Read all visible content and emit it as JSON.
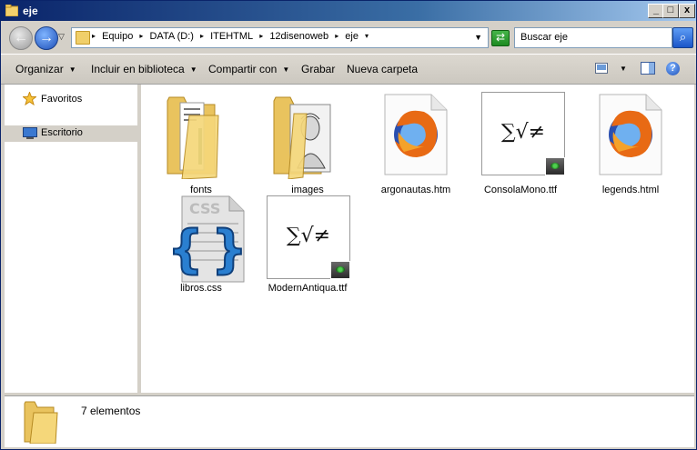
{
  "window": {
    "title": "eje",
    "controls": [
      "_",
      "□",
      "x"
    ]
  },
  "navigation": {
    "back_icon": "back-arrow-icon",
    "forward_icon": "forward-arrow-icon",
    "address_crumbs": [
      "Equipo",
      "DATA (D:)",
      "ITEHTML",
      "12disenoweb",
      "eje"
    ],
    "search_placeholder": "Buscar eje"
  },
  "command_bar": {
    "organize": "Organizar",
    "include": "Incluir en biblioteca",
    "share": "Compartir con",
    "burn": "Grabar",
    "new_folder": "Nueva carpeta",
    "help": "?"
  },
  "nav_pane": {
    "favorites": "Favoritos",
    "desktop": "Escritorio"
  },
  "files": [
    {
      "name": "fonts",
      "type": "folder"
    },
    {
      "name": "images",
      "type": "folder"
    },
    {
      "name": "argonautas.htm",
      "type": "firefox-html"
    },
    {
      "name": "ConsolaMono.ttf",
      "type": "font"
    },
    {
      "name": "legends.html",
      "type": "firefox-html"
    },
    {
      "name": "libros.css",
      "type": "css"
    },
    {
      "name": "ModernAntiqua.ttf",
      "type": "font"
    }
  ],
  "font_preview_glyphs": "∑√≠",
  "css_badge": "CSS",
  "status": {
    "count": "7 elementos"
  }
}
